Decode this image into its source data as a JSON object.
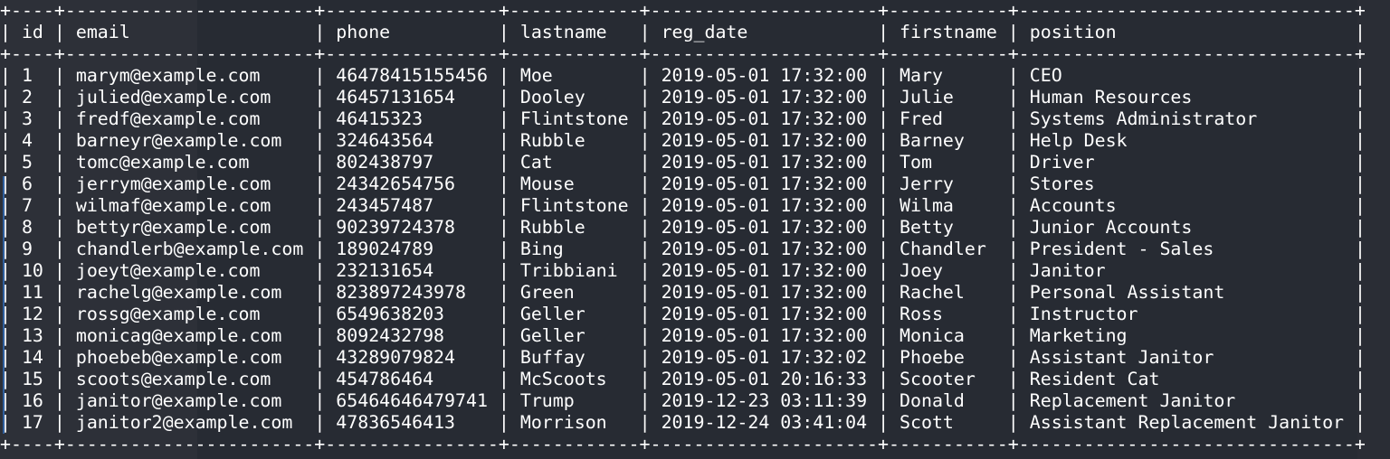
{
  "table": {
    "columns": [
      {
        "key": "id",
        "label": "id"
      },
      {
        "key": "email",
        "label": "email"
      },
      {
        "key": "phone",
        "label": "phone"
      },
      {
        "key": "lastname",
        "label": "lastname"
      },
      {
        "key": "reg_date",
        "label": "reg_date"
      },
      {
        "key": "firstname",
        "label": "firstname"
      },
      {
        "key": "position",
        "label": "position"
      }
    ],
    "rows": [
      [
        "1",
        "marym@example.com",
        "46478415155456",
        "Moe",
        "2019-05-01 17:32:00",
        "Mary",
        "CEO"
      ],
      [
        "2",
        "julied@example.com",
        "46457131654",
        "Dooley",
        "2019-05-01 17:32:00",
        "Julie",
        "Human Resources"
      ],
      [
        "3",
        "fredf@example.com",
        "46415323",
        "Flintstone",
        "2019-05-01 17:32:00",
        "Fred",
        "Systems Administrator"
      ],
      [
        "4",
        "barneyr@example.com",
        "324643564",
        "Rubble",
        "2019-05-01 17:32:00",
        "Barney",
        "Help Desk"
      ],
      [
        "5",
        "tomc@example.com",
        "802438797",
        "Cat",
        "2019-05-01 17:32:00",
        "Tom",
        "Driver"
      ],
      [
        "6",
        "jerrym@example.com",
        "24342654756",
        "Mouse",
        "2019-05-01 17:32:00",
        "Jerry",
        "Stores"
      ],
      [
        "7",
        "wilmaf@example.com",
        "243457487",
        "Flintstone",
        "2019-05-01 17:32:00",
        "Wilma",
        "Accounts"
      ],
      [
        "8",
        "bettyr@example.com",
        "90239724378",
        "Rubble",
        "2019-05-01 17:32:00",
        "Betty",
        "Junior Accounts"
      ],
      [
        "9",
        "chandlerb@example.com",
        "189024789",
        "Bing",
        "2019-05-01 17:32:00",
        "Chandler",
        "President - Sales"
      ],
      [
        "10",
        "joeyt@example.com",
        "232131654",
        "Tribbiani",
        "2019-05-01 17:32:00",
        "Joey",
        "Janitor"
      ],
      [
        "11",
        "rachelg@example.com",
        "823897243978",
        "Green",
        "2019-05-01 17:32:00",
        "Rachel",
        "Personal Assistant"
      ],
      [
        "12",
        "rossg@example.com",
        "6549638203",
        "Geller",
        "2019-05-01 17:32:00",
        "Ross",
        "Instructor"
      ],
      [
        "13",
        "monicag@example.com",
        "8092432798",
        "Geller",
        "2019-05-01 17:32:00",
        "Monica",
        "Marketing"
      ],
      [
        "14",
        "phoebeb@example.com",
        "43289079824",
        "Buffay",
        "2019-05-01 17:32:02",
        "Phoebe",
        "Assistant Janitor"
      ],
      [
        "15",
        "scoots@example.com",
        "454786464",
        "McScoots",
        "2019-05-01 20:16:33",
        "Scooter",
        "Resident Cat"
      ],
      [
        "16",
        "janitor@example.com",
        "65464646479741",
        "Trump",
        "2019-12-23 03:11:39",
        "Donald",
        "Replacement Janitor"
      ],
      [
        "17",
        "janitor2@example.com",
        "47836546413",
        "Morrison",
        "2019-12-24 03:41:04",
        "Scott",
        "Assistant Replacement Janitor"
      ]
    ]
  },
  "colors": {
    "background": "#272b33",
    "text": "#ffffff",
    "accent": "#2f5f9e"
  }
}
